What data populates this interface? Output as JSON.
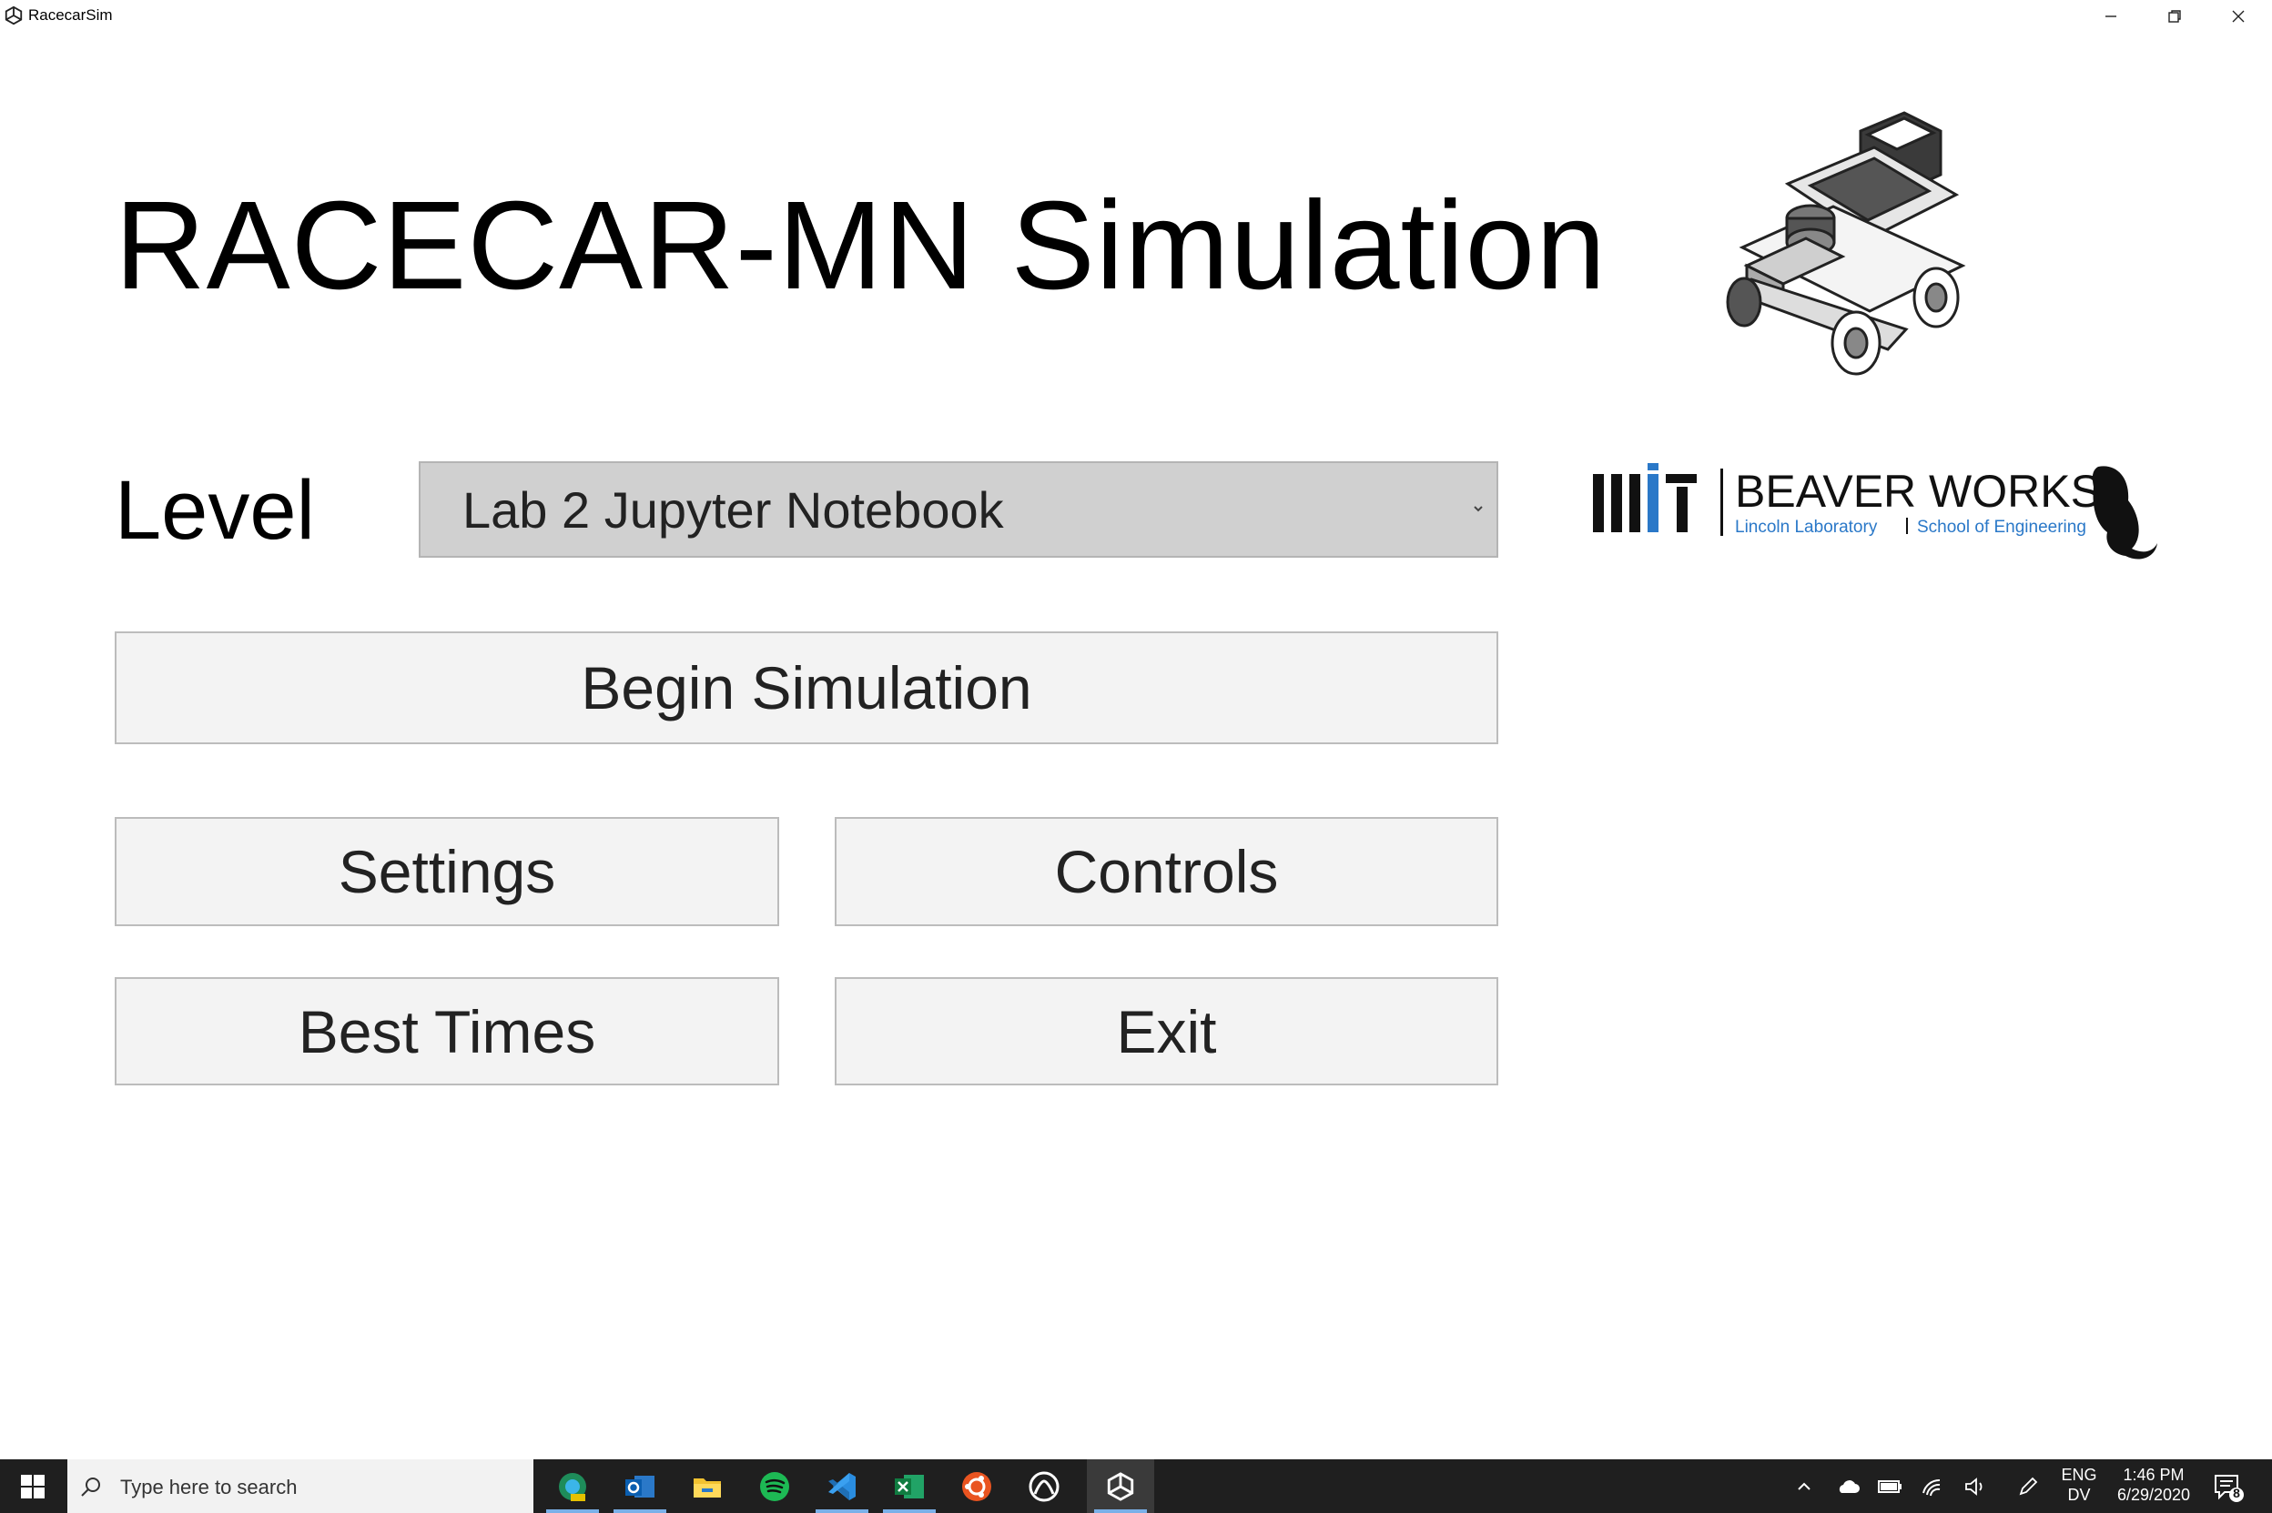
{
  "window": {
    "title": "RacecarSim",
    "icon": "unity-icon",
    "controls": [
      "minimize-icon",
      "restore-icon",
      "close-icon"
    ]
  },
  "main": {
    "title": "RACECAR-MN Simulation",
    "level_label": "Level",
    "level_select": {
      "selected": "Lab 2 Jupyter Notebook"
    },
    "logo": {
      "brand": "BEAVER WORKS",
      "left_sub": "Lincoln Laboratory",
      "right_sub": "School of Engineering",
      "brand_color": "#2a78c8"
    },
    "buttons": {
      "begin": "Begin Simulation",
      "settings": "Settings",
      "controls": "Controls",
      "best_times": "Best Times",
      "exit": "Exit"
    }
  },
  "taskbar": {
    "search_placeholder": "Type here to search",
    "apps": [
      "edge-dev-icon",
      "outlook-icon",
      "file-explorer-icon",
      "spotify-icon",
      "vscode-icon",
      "excel-icon",
      "ubuntu-icon",
      "xbox-icon",
      "unity-icon"
    ],
    "tray": {
      "lang_top": "ENG",
      "lang_bottom": "DV",
      "time": "1:46 PM",
      "date": "6/29/2020",
      "notification_count": "8"
    }
  }
}
